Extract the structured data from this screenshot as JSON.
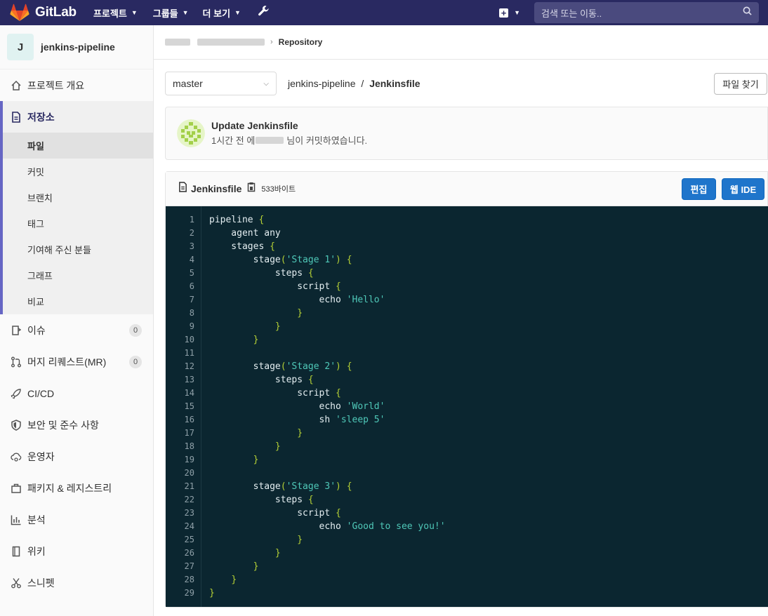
{
  "nav": {
    "brand": "GitLab",
    "menu": [
      "프로젝트",
      "그룹들",
      "더 보기"
    ],
    "search_placeholder": "검색 또는 이동.."
  },
  "sidebar": {
    "project_initial": "J",
    "project_name": "jenkins-pipeline",
    "overview": "프로젝트 개요",
    "repository": "저장소",
    "repo_items": [
      "파일",
      "커밋",
      "브랜치",
      "태그",
      "기여해 주신 분들",
      "그래프",
      "비교"
    ],
    "items": [
      {
        "label": "이슈",
        "count": "0"
      },
      {
        "label": "머지 리퀘스트(MR)",
        "count": "0"
      },
      {
        "label": "CI/CD"
      },
      {
        "label": "보안 및 준수 사항"
      },
      {
        "label": "운영자"
      },
      {
        "label": "패키지 & 레지스트리"
      },
      {
        "label": "분석"
      },
      {
        "label": "위키"
      },
      {
        "label": "스니펫"
      }
    ]
  },
  "breadcrumb": {
    "current": "Repository"
  },
  "file_bar": {
    "branch": "master",
    "path_project": "jenkins-pipeline",
    "path_sep": "/",
    "path_file": "Jenkinsfile",
    "find_file": "파일 찾기"
  },
  "commit": {
    "title": "Update Jenkinsfile",
    "meta_prefix": "1시간 전 에",
    "meta_suffix": "님이 커밋하였습니다."
  },
  "file": {
    "name": "Jenkinsfile",
    "size": "533바이트",
    "edit": "편집",
    "web_ide": "웹 IDE"
  },
  "code_lines": [
    "pipeline {",
    "    agent any",
    "    stages {",
    "        stage('Stage 1') {",
    "            steps {",
    "                script {",
    "                    echo 'Hello'",
    "                }",
    "            }",
    "        }",
    "",
    "        stage('Stage 2') {",
    "            steps {",
    "                script {",
    "                    echo 'World'",
    "                    sh 'sleep 5'",
    "                }",
    "            }",
    "        }",
    "",
    "        stage('Stage 3') {",
    "            steps {",
    "                script {",
    "                    echo 'Good to see you!'",
    "                }",
    "            }",
    "        }",
    "    }",
    "}"
  ],
  "colors": {
    "navbar": "#292961",
    "accent": "#1f75cb",
    "code_bg": "#0b2630"
  }
}
